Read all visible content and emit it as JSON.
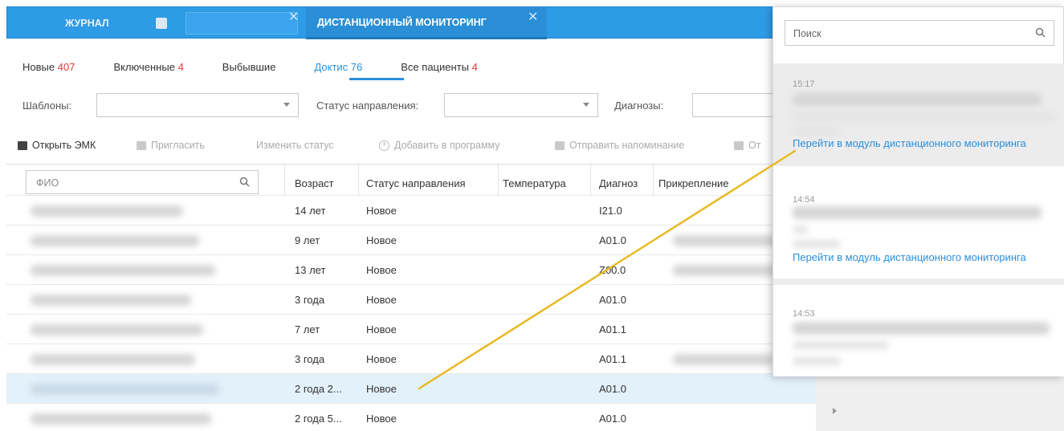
{
  "tabs": {
    "journal": "ЖУРНАЛ",
    "patient_close": "✕",
    "monitoring": "ДИСТАНЦИОННЫЙ МОНИТОРИНГ",
    "monitoring_close": "✕"
  },
  "subtabs": [
    {
      "label": "Новые",
      "count": "407"
    },
    {
      "label": "Включенные",
      "count": "4"
    },
    {
      "label": "Выбывшие",
      "count": ""
    },
    {
      "label": "Доктис",
      "count": "76"
    },
    {
      "label": "Все пациенты",
      "count": "4"
    }
  ],
  "filters": {
    "templates_label": "Шаблоны:",
    "status_label": "Статус направления:",
    "diagnoses_label": "Диагнозы:"
  },
  "toolbar": {
    "open_emk": "Открыть ЭМК",
    "invite": "Пригласить",
    "change_status": "Изменить статус",
    "add_to_program": "Добавить в программу",
    "send_reminder": "Отправить напоминание",
    "truncated": "От"
  },
  "table": {
    "search_placeholder": "ФИО",
    "headers": {
      "age": "Возраст",
      "status": "Статус направления",
      "temperature": "Температура",
      "diagnosis": "Диагноз",
      "attachment": "Прикрепление"
    },
    "rows": [
      {
        "age": "14 лет",
        "status": "Новое",
        "diagnosis": "I21.0"
      },
      {
        "age": "9 лет",
        "status": "Новое",
        "diagnosis": "A01.0"
      },
      {
        "age": "13 лет",
        "status": "Новое",
        "diagnosis": "Z00.0"
      },
      {
        "age": "3 года",
        "status": "Новое",
        "diagnosis": "A01.0"
      },
      {
        "age": "7 лет",
        "status": "Новое",
        "diagnosis": "A01.1"
      },
      {
        "age": "3 года",
        "status": "Новое",
        "diagnosis": "A01.1"
      },
      {
        "age": "2 года 2...",
        "status": "Новое",
        "diagnosis": "A01.0"
      },
      {
        "age": "2 года 5...",
        "status": "Новое",
        "diagnosis": "A01.0"
      }
    ]
  },
  "panel": {
    "search_placeholder": "Поиск",
    "notifications": [
      {
        "time": "15:17",
        "link": "Перейти в модуль дистанционного мониторинга"
      },
      {
        "time": "14:54",
        "link": "Перейти в модуль дистанционного мониторинга"
      },
      {
        "time": "14:53",
        "link": ""
      }
    ]
  },
  "colors": {
    "tab_bar": "#2e9be6",
    "accent": "#2b8fdc",
    "count_red": "#e53935",
    "pointer_line": "#e8b923"
  }
}
